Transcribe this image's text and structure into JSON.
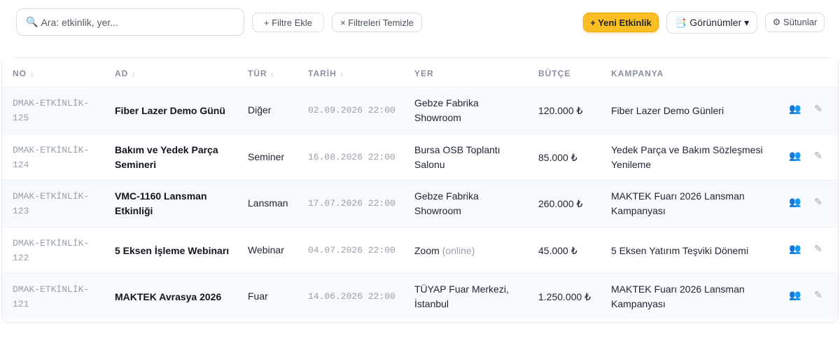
{
  "toolbar": {
    "search_icon": "🔍",
    "search_placeholder": "Ara: etkinlik, yer...",
    "add_filter": "+ Filtre Ekle",
    "clear_filters": "× Filtreleri Temizle",
    "new_event": "+ Yeni Etkinlik",
    "views_icon": "📑",
    "views": "Görünümler ▾",
    "columns": "⚙ Sütunlar"
  },
  "table": {
    "columns": [
      "NO",
      "AD",
      "TÜR",
      "TARİH",
      "YER",
      "BÜTÇE",
      "KAMPANYA"
    ],
    "sort_glyph": "↕",
    "rows": [
      {
        "no": "DMAK-ETKİNLİK-125",
        "ad": "Fiber Lazer Demo Günü",
        "tur": "Diğer",
        "tarih": "02.09.2026 22:00",
        "yer": "Gebze Fabrika Showroom",
        "yer_sub": "",
        "butce": "120.000 ₺",
        "kampanya": "Fiber Lazer Demo Günleri"
      },
      {
        "no": "DMAK-ETKİNLİK-124",
        "ad": "Bakım ve Yedek Parça Semineri",
        "tur": "Seminer",
        "tarih": "16.08.2026 22:00",
        "yer": "Bursa OSB Toplantı Salonu",
        "yer_sub": "",
        "butce": "85.000 ₺",
        "kampanya": "Yedek Parça ve Bakım Sözleşmesi Yenileme"
      },
      {
        "no": "DMAK-ETKİNLİK-123",
        "ad": "VMC-1160 Lansman Etkinliği",
        "tur": "Lansman",
        "tarih": "17.07.2026 22:00",
        "yer": "Gebze Fabrika Showroom",
        "yer_sub": "",
        "butce": "260.000 ₺",
        "kampanya": "MAKTEK Fuarı 2026 Lansman Kampanyası"
      },
      {
        "no": "DMAK-ETKİNLİK-122",
        "ad": "5 Eksen İşleme Webinarı",
        "tur": "Webinar",
        "tarih": "04.07.2026 22:00",
        "yer": "Zoom",
        "yer_sub": "(online)",
        "butce": "45.000 ₺",
        "kampanya": "5 Eksen Yatırım Teşviki Dönemi"
      },
      {
        "no": "DMAK-ETKİNLİK-121",
        "ad": "MAKTEK Avrasya 2026",
        "tur": "Fuar",
        "tarih": "14.06.2026 22:00",
        "yer": "TÜYAP Fuar Merkezi, İstanbul",
        "yer_sub": "",
        "butce": "1.250.000 ₺",
        "kampanya": "MAKTEK Fuarı 2026 Lansman Kampanyası"
      }
    ],
    "action_icons": {
      "attendees": "👥",
      "edit": "✎"
    }
  }
}
